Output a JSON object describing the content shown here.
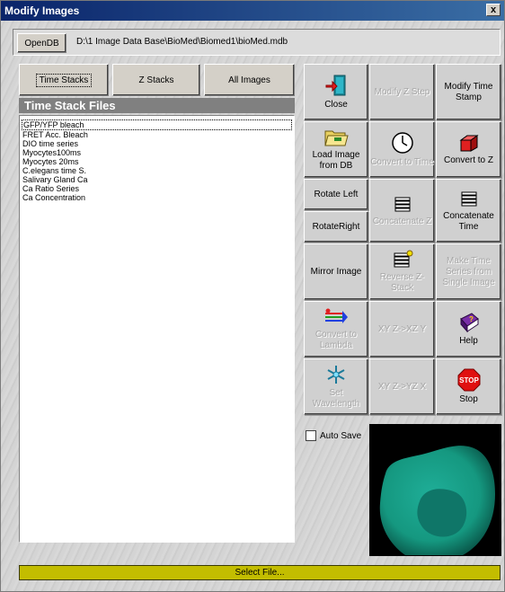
{
  "window": {
    "title": "Modify Images",
    "close_label": "x"
  },
  "db": {
    "open_label": "OpenDB",
    "path": "D:\\1 Image Data Base\\BioMed\\Biomed1\\bioMed.mdb"
  },
  "tabs": [
    "Time Stacks",
    "Z Stacks",
    "All Images"
  ],
  "list": {
    "header": "Time Stack Files",
    "items": [
      "GFP/YFP bleach",
      "FRET Acc. Bleach",
      "DIO time series",
      "Myocytes100ms",
      "Myocytes 20ms",
      "C.elegans time S.",
      "Salivary Gland Ca",
      "Ca Ratio Series",
      "Ca Concentration"
    ]
  },
  "buttons": {
    "close": "Close",
    "modify_z_step": "Modify Z Step",
    "modify_time_stamp": "Modify Time Stamp",
    "load_image": "Load Image from DB",
    "convert_to_time": "Convert to Time",
    "convert_to_z": "Convert to Z",
    "rotate_left": "Rotate Left",
    "rotate_right": "RotateRight",
    "concatenate_z": "Concatenate Z",
    "concatenate_time": "Concatenate Time",
    "mirror_image": "Mirror Image",
    "reverse_z_stack": "Reverse Z-Stack",
    "make_time_series": "Make Time Series from Single Image",
    "convert_to_lambda": "Convert to Lambda",
    "xy_z_xz_y": "XY Z->XZ Y",
    "help": "Help",
    "set_wavelength": "Set Wavelength",
    "xy_z_yz_x": "XY Z->YZ X",
    "stop": "Stop"
  },
  "auto_save": {
    "label": "Auto Save",
    "checked": false
  },
  "status": {
    "text": "Select File...",
    "color": "#c3bd00"
  },
  "icons": {
    "close": "door-exit-icon",
    "load": "open-folder-icon",
    "time": "clock-icon",
    "to_z": "red-cube-icon",
    "stack": "image-stack-icon",
    "convert_lambda": "spectrum-arrows-icon",
    "help": "help-book-icon",
    "wavelength": "snowflake-icon",
    "stop": "stop-sign-icon"
  }
}
